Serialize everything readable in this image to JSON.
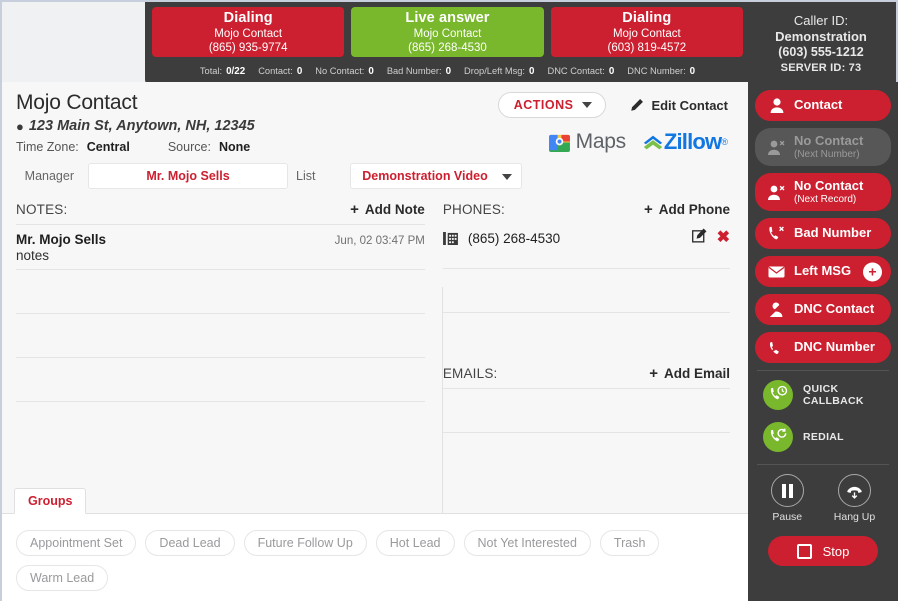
{
  "topbar": {
    "status_cards": [
      {
        "title": "Dialing",
        "subtitle": "Mojo Contact",
        "phone": "(865) 935-9774",
        "color": "#cc2030"
      },
      {
        "title": "Live answer",
        "subtitle": "Mojo Contact",
        "phone": "(865) 268-4530",
        "color": "#79b72c"
      },
      {
        "title": "Dialing",
        "subtitle": "Mojo Contact",
        "phone": "(603) 819-4572",
        "color": "#cc2030"
      }
    ],
    "stats": [
      {
        "label": "Total:",
        "value": "0/22"
      },
      {
        "label": "Contact:",
        "value": "0"
      },
      {
        "label": "No Contact:",
        "value": "0"
      },
      {
        "label": "Bad Number:",
        "value": "0"
      },
      {
        "label": "Drop/Left Msg:",
        "value": "0"
      },
      {
        "label": "DNC Contact:",
        "value": "0"
      },
      {
        "label": "DNC Number:",
        "value": "0"
      }
    ]
  },
  "caller_id": {
    "line1": "Caller ID:",
    "line2": "Demonstration",
    "line3": "(603) 555-1212",
    "line4": "SERVER ID: 73"
  },
  "contact": {
    "name": "Mojo Contact",
    "address": "123 Main St, Anytown, NH, 12345",
    "timezone_label": "Time Zone:",
    "timezone_value": "Central",
    "source_label": "Source:",
    "source_value": "None",
    "actions_label": "ACTIONS",
    "edit_label": "Edit Contact",
    "maps_label": "Maps",
    "zillow_label": "Zillow"
  },
  "fields": {
    "manager_label": "Manager",
    "manager_value": "Mr. Mojo Sells",
    "list_label": "List",
    "list_value": "Demonstration Video"
  },
  "notes": {
    "title": "NOTES:",
    "add_label": "Add Note",
    "items": [
      {
        "author": "Mr. Mojo Sells",
        "date": "Jun, 02 03:47 PM",
        "body": "notes"
      }
    ]
  },
  "phones": {
    "title": "PHONES:",
    "add_label": "Add Phone",
    "items": [
      {
        "number": "(865) 268-4530",
        "type_icon": "office-phone-icon"
      }
    ]
  },
  "emails": {
    "title": "EMAILS:",
    "add_label": "Add Email",
    "items": []
  },
  "groups": {
    "tab_label": "Groups",
    "pills": [
      "Appointment Set",
      "Dead Lead",
      "Future Follow Up",
      "Hot Lead",
      "Not Yet Interested",
      "Trash",
      "Warm Lead"
    ]
  },
  "sidebar": {
    "disposition_buttons": [
      {
        "label": "Contact",
        "sublabel": "",
        "icon": "person-icon",
        "state": "enabled",
        "badge": ""
      },
      {
        "label": "No Contact",
        "sublabel": "(Next Number)",
        "icon": "person-x-icon",
        "state": "disabled",
        "badge": ""
      },
      {
        "label": "No Contact",
        "sublabel": "(Next Record)",
        "icon": "person-x-icon",
        "state": "enabled",
        "badge": ""
      },
      {
        "label": "Bad Number",
        "sublabel": "",
        "icon": "phone-x-icon",
        "state": "enabled",
        "badge": ""
      },
      {
        "label": "Left MSG",
        "sublabel": "",
        "icon": "envelope-icon",
        "state": "enabled",
        "badge": "+"
      },
      {
        "label": "DNC Contact",
        "sublabel": "",
        "icon": "person-slash-icon",
        "state": "enabled",
        "badge": ""
      },
      {
        "label": "DNC Number",
        "sublabel": "",
        "icon": "phone-slash-icon",
        "state": "enabled",
        "badge": ""
      }
    ],
    "callback_buttons": [
      {
        "label": "QUICK CALLBACK",
        "icon": "phone-clock-icon"
      },
      {
        "label": "REDIAL",
        "icon": "phone-refresh-icon"
      }
    ],
    "controls": [
      {
        "label": "Pause",
        "icon": "pause-icon"
      },
      {
        "label": "Hang Up",
        "icon": "hangup-icon"
      }
    ],
    "stop_label": "Stop"
  },
  "colors": {
    "red": "#cc2030",
    "green": "#79b72c",
    "dark": "#3d3d3d",
    "zillow_blue": "#1277e1"
  }
}
